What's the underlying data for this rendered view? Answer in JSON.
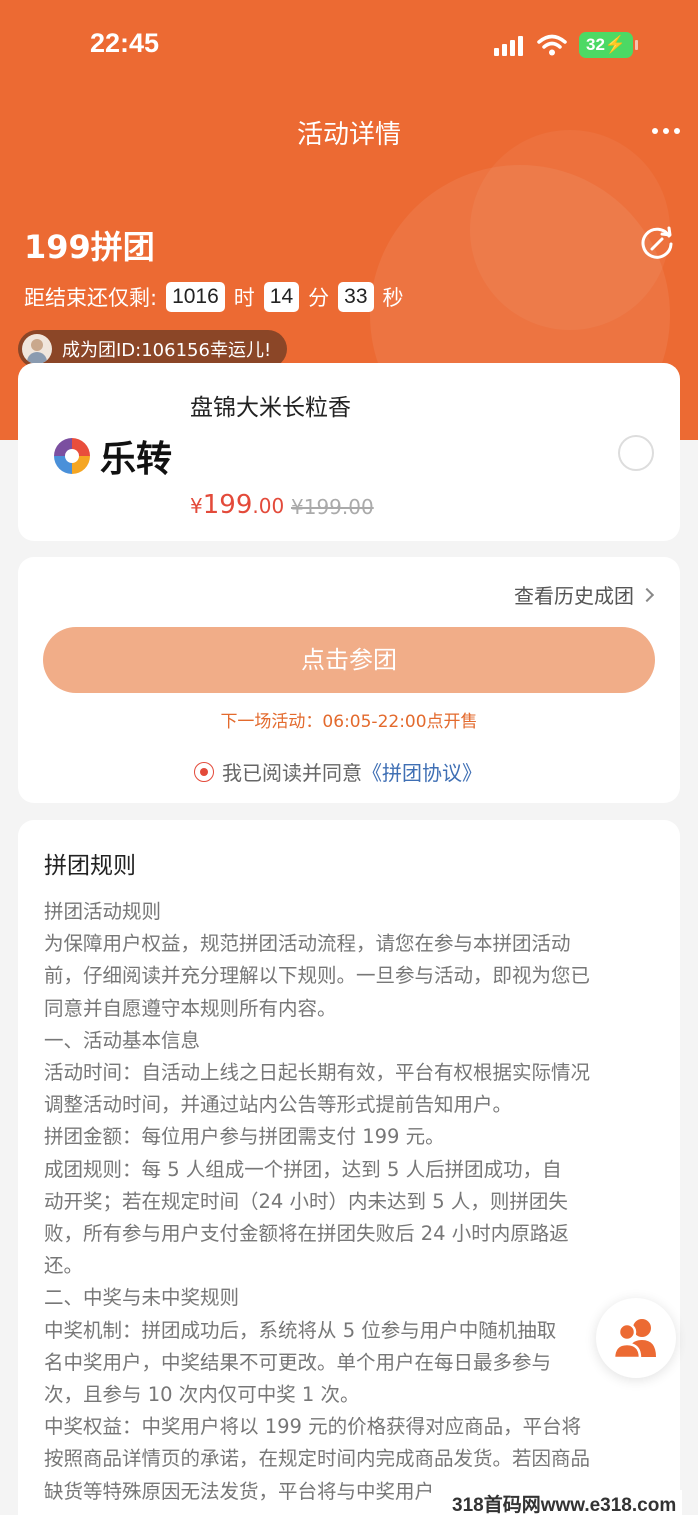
{
  "status_bar": {
    "time": "22:45",
    "battery": "32"
  },
  "nav": {
    "title": "活动详情"
  },
  "activity": {
    "title": "199拼团",
    "countdown_label": "距结束还仅剩:",
    "hours": "1016",
    "hours_unit": "时",
    "minutes": "14",
    "minutes_unit": "分",
    "seconds": "33",
    "seconds_unit": "秒",
    "winner_text": "成为团ID:106156幸运儿!"
  },
  "product": {
    "name": "盘锦大米长粒香",
    "logo_text": "乐转",
    "price_symbol": "¥",
    "price_int": "199",
    "price_dec": ".00",
    "original_price": "¥199.00"
  },
  "join": {
    "history_link": "查看历史成团",
    "button_label": "点击参团",
    "next_session": "下一场活动：06:05-22:00点开售",
    "agree_text": "我已阅读并同意",
    "agreement_link": "《拼团协议》"
  },
  "rules": {
    "title": "拼团规则",
    "lines": [
      "拼团活动规则",
      "为保障用户权益，规范拼团活动流程，请您在参与本拼团活动",
      "前，仔细阅读并充分理解以下规则。一旦参与活动，即视为您已",
      "同意并自愿遵守本规则所有内容。",
      "一、活动基本信息",
      "活动时间：自活动上线之日起长期有效，平台有权根据实际情况",
      "调整活动时间，并通过站内公告等形式提前告知用户。",
      "拼团金额：每位用户参与拼团需支付 199 元。",
      "成团规则：每 5 人组成一个拼团，达到 5 人后拼团成功，自",
      "动开奖；若在规定时间（24 小时）内未达到 5 人，则拼团失",
      "败，所有参与用户支付金额将在拼团失败后 24 小时内原路返",
      "还。",
      "二、中奖与未中奖规则",
      "中奖机制：拼团成功后，系统将从 5 位参与用户中随机抽取",
      "名中奖用户，中奖结果不可更改。单个用户在每日最多参与",
      "次，且参与 10 次内仅可中奖 1 次。",
      "中奖权益：中奖用户将以 199 元的价格获得对应商品，平台将",
      "按照商品详情页的承诺，在规定时间内完成商品发货。若因商品",
      "缺货等特殊原因无法发货，平台将与中奖用户"
    ]
  },
  "watermark": "318首码网www.e318.com",
  "colors": {
    "primary": "#ec6a33",
    "button": "#f1ad88",
    "price": "#e34a3a",
    "link": "#3f6fb4"
  }
}
